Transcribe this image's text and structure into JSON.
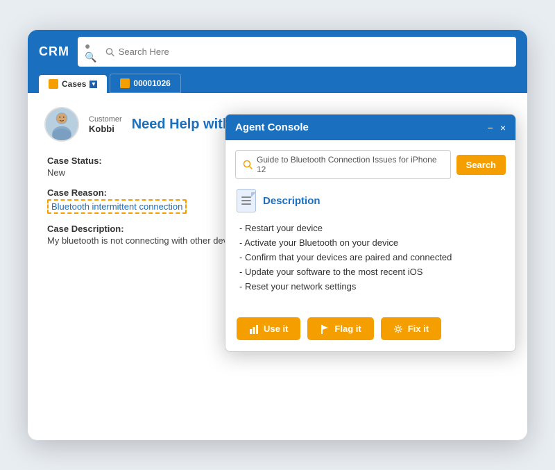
{
  "app": {
    "title": "CRM",
    "search_placeholder": "Search Here"
  },
  "tabs": [
    {
      "label": "Cases",
      "active": true,
      "icon": "cases-icon",
      "has_dropdown": true
    },
    {
      "label": "00001026",
      "active": false,
      "icon": "case-icon",
      "has_dropdown": false
    }
  ],
  "case": {
    "customer_label": "Customer",
    "customer_name": "Kobbi",
    "title": "Need Help with Intermittent Bluetooth Connection",
    "status_label": "Case Status:",
    "status_value": "New",
    "reason_label": "Case Reason:",
    "reason_value": "Bluetooth intermittent connection",
    "description_label": "Case Description:",
    "description_value": "My bluetooth is not connecting with other devices"
  },
  "agent_console": {
    "title": "Agent Console",
    "minimize_label": "−",
    "close_label": "×",
    "search_query": "Guide to Bluetooth Connection Issues for iPhone 12",
    "search_button_label": "Search",
    "description_title": "Description",
    "description_items": [
      "- Restart your device",
      "- Activate your Bluetooth on your device",
      "- Confirm that your devices are paired and connected",
      "- Update your software to the most recent iOS",
      "- Reset your network settings"
    ],
    "buttons": [
      {
        "label": "Use it",
        "icon": "bar-chart-icon"
      },
      {
        "label": "Flag it",
        "icon": "flag-icon"
      },
      {
        "label": "Fix it",
        "icon": "gear-icon"
      }
    ]
  },
  "colors": {
    "primary": "#1a6fbf",
    "accent": "#f59e00",
    "white": "#ffffff"
  }
}
